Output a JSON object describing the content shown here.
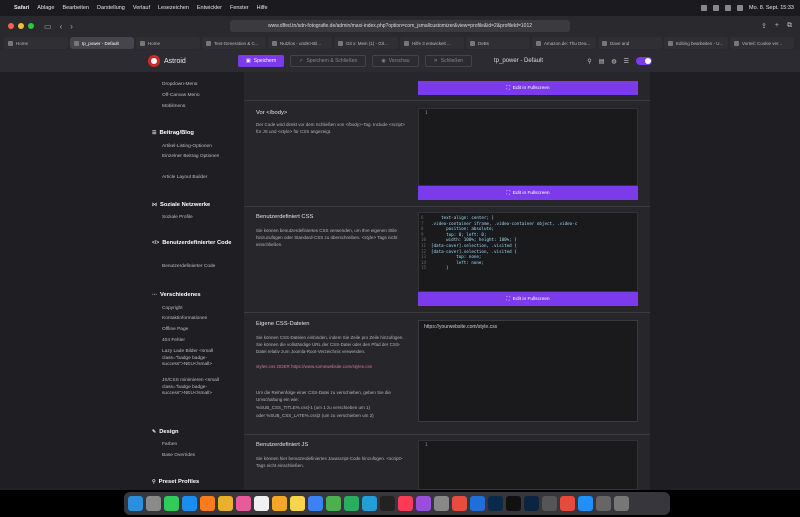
{
  "menubar": {
    "app": "Safari",
    "items": [
      "Ablage",
      "Bearbeiten",
      "Darstellung",
      "Verlauf",
      "Lesezeichen",
      "Entwickler",
      "Fenster",
      "Hilfe"
    ],
    "clock": "Mo. 8. Sept. 15:33"
  },
  "browser": {
    "url": "www.dlfed.tn/sdn-fotografie.de/admin/maxi-index.php?option=com_jsmallcustomizer&view=profile&id=2&profileId=1012",
    "tabs": [
      {
        "label": "Home",
        "active": false
      },
      {
        "label": "tp_power - Default",
        "active": true
      },
      {
        "label": "Home",
        "active": false
      },
      {
        "label": "Text-Generation & C...",
        "active": false
      },
      {
        "label": "Nutzlos - undKI-Bil...",
        "active": false
      },
      {
        "label": "Git x: Mein (1) - Git...",
        "active": false
      },
      {
        "label": "Hilfe 3 entwickelt ...",
        "active": false
      },
      {
        "label": "DeBs",
        "active": false
      },
      {
        "label": "Amazon.de: Thu Dea...",
        "active": false
      },
      {
        "label": "Dave and",
        "active": false
      },
      {
        "label": "Editing bearbeiten - U...",
        "active": false
      },
      {
        "label": "Vorteil: Cookie ver...",
        "active": false
      }
    ]
  },
  "app": {
    "name": "Astroid",
    "save": "Speichern",
    "save_close": "Speichern & Schließen",
    "preview": "Vorschau",
    "close": "Schließen",
    "page_title": "tp_power - Default"
  },
  "sidebar": {
    "top_items": [
      "Dropdown-Menü",
      "Off-Canvas Menü",
      "Mobilmenü"
    ],
    "sec_blog": "Beitrag/Blog",
    "blog_items": [
      "Artikel-Listing-Optionen",
      "Einzelner Beitrag Optionen",
      "Article Layout Builder"
    ],
    "sec_social": "Soziale Netzwerke",
    "social_items": [
      "Soziale Profile"
    ],
    "sec_code": "Benutzerdefinierter Code",
    "code_items": [
      "Benutzerdefinierter Code"
    ],
    "sec_misc": "Verschiedenes",
    "misc_items": [
      "Copyright",
      "Kontaktinformationen",
      "Offline Page",
      "404 Fehler",
      "Lazy Lade Bilder <small class=\"badge badge-success\">NEU</small>",
      "JS/CSS minimieren <small class=\"badge badge-success\">NEU</small>"
    ],
    "sec_design": "Design",
    "design_items": [
      "Farben",
      "Base Overrides"
    ],
    "sec_preset": "Preset Profiles"
  },
  "content": {
    "fullscreen": "Edit in Fullscreen",
    "body_title": "Vor </body>",
    "body_desc": "Der Code wird direkt vor dem Schließen von </body>-Tag. Include <script> für JS und <style> für CSS angezeigt.",
    "css_title": "Benutzerdefiniert CSS",
    "css_desc": "Sie können benutzerdefiniertes CSS verwenden, um Ihre eigenen Stile hinzuzufügen oder Standard-CSS zu überschreiben. <style> Tags nicht einschließen.",
    "files_title": "Eigene CSS-Dateien",
    "files_desc": "Sie können CSS-Dateien einbinden, indem Sie Zeile pro Zeile hinzufügen. Sie können die vollständige URL der CSS-Datei oder den Pfad der CSS-Datei relativ zum Joomla-Root-Verzeichnis verwenden.",
    "files_example": "styles.css ODER https://www.somewebsite.com/styles.css",
    "files_order": "Um die Reihenfolge einer CSS-Datei zu verschieben, geben Sie die Umschaltung ein wie:",
    "files_up": "%SUB_CSS_TITLE%.css|-1 (um 1 zu verschieben um 1)",
    "files_down": "oder %SUB_CSS_LATE%.css|2 (um zu verschieben um 2)",
    "files_value": "https://yourwebsite.com/style.css",
    "js_title": "Benutzerdefiniert JS",
    "js_desc": "Sie können hier benutzerdefiniertes Javascript-Code hinzufügen. <script> Tags nicht einschließen.",
    "line1": "1"
  },
  "css_code": [
    {
      "n": "6",
      "t": "    text-align: center; }"
    },
    {
      "n": "7",
      "t": ".video-container iframe, .video-container object, .video-c"
    },
    {
      "n": "8",
      "t": "      position: absolute;"
    },
    {
      "n": "9",
      "t": "      top: 0; left: 0;"
    },
    {
      "n": "10",
      "t": "      width: 100%; height: 100%; }"
    },
    {
      "n": "11",
      "t": "[data-cover].selection, .visited {"
    },
    {
      "n": "12",
      "t": "[data-cover].selection, .visited {"
    },
    {
      "n": "13",
      "t": "          top: none;"
    },
    {
      "n": "14",
      "t": "          left: none;"
    },
    {
      "n": "15",
      "t": "      }"
    }
  ],
  "dock": {
    "apps": [
      {
        "label": "Finder",
        "color": "#2b8fe0"
      },
      {
        "label": "Launchpad",
        "color": "#8a8a8a"
      },
      {
        "label": "Messages",
        "color": "#2fcc59"
      },
      {
        "label": "Safari",
        "color": "#1a8ef0"
      },
      {
        "label": "Firefox",
        "color": "#ff7b1a"
      },
      {
        "label": "Chrome",
        "color": "#eab02a"
      },
      {
        "label": "Photos",
        "color": "#e85a9a"
      },
      {
        "label": "Calendar",
        "color": "#f0f0f0"
      },
      {
        "label": "Reminders",
        "color": "#f5a623"
      },
      {
        "label": "Notes",
        "color": "#f7d44a"
      },
      {
        "label": "Mail",
        "color": "#3b82f6"
      },
      {
        "label": "Maps",
        "color": "#4caf50"
      },
      {
        "label": "FaceTime",
        "color": "#27ae60"
      },
      {
        "label": "Telegram",
        "color": "#229ed9"
      },
      {
        "label": "TV",
        "color": "#222"
      },
      {
        "label": "Music",
        "color": "#fa3c55"
      },
      {
        "label": "Podcasts",
        "color": "#9b4de0"
      },
      {
        "label": "Settings",
        "color": "#888"
      },
      {
        "label": "Pinwheel",
        "color": "#e74c3c"
      },
      {
        "label": "Xcode",
        "color": "#1e6fd9"
      },
      {
        "label": "Ps",
        "color": "#0a2a4a"
      },
      {
        "label": "Terminal",
        "color": "#111"
      },
      {
        "label": "Lrc",
        "color": "#0b2540"
      },
      {
        "label": "Calculator",
        "color": "#555"
      },
      {
        "label": "Affinity",
        "color": "#e8493b"
      },
      {
        "label": "Store",
        "color": "#1e90ff"
      },
      {
        "label": "Downloads",
        "color": "#666"
      },
      {
        "label": "Trash",
        "color": "#777"
      }
    ]
  }
}
